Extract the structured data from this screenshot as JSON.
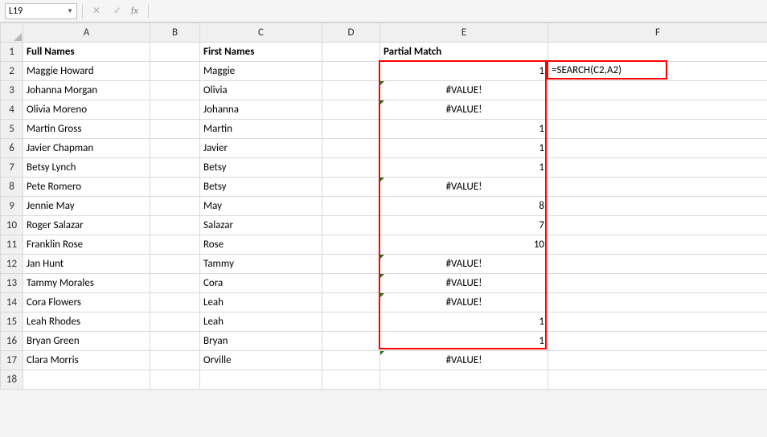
{
  "name_box": "L19",
  "fx_label": "fx",
  "cancel_glyph": "✕",
  "enter_glyph": "✓",
  "columns": [
    "A",
    "B",
    "C",
    "D",
    "E",
    "F"
  ],
  "headers": {
    "a": "Full Names",
    "c": "First Names",
    "e": "Partial Match"
  },
  "formula_display": "=SEARCH(C2,A2)",
  "rows": [
    {
      "r": 2,
      "a": "Maggie Howard",
      "c": "Maggie",
      "e": "1",
      "etype": "num"
    },
    {
      "r": 3,
      "a": "Johanna Morgan",
      "c": "Olivia",
      "e": "#VALUE!",
      "etype": "err"
    },
    {
      "r": 4,
      "a": "Olivia Moreno",
      "c": "Johanna",
      "e": "#VALUE!",
      "etype": "err"
    },
    {
      "r": 5,
      "a": "Martin Gross",
      "c": "Martin",
      "e": "1",
      "etype": "num"
    },
    {
      "r": 6,
      "a": "Javier Chapman",
      "c": "Javier",
      "e": "1",
      "etype": "num"
    },
    {
      "r": 7,
      "a": "Betsy Lynch",
      "c": "Betsy",
      "e": "1",
      "etype": "num"
    },
    {
      "r": 8,
      "a": "Pete Romero",
      "c": "Betsy",
      "e": "#VALUE!",
      "etype": "err"
    },
    {
      "r": 9,
      "a": "Jennie May",
      "c": "May",
      "e": "8",
      "etype": "num"
    },
    {
      "r": 10,
      "a": "Roger Salazar",
      "c": "Salazar",
      "e": "7",
      "etype": "num"
    },
    {
      "r": 11,
      "a": "Franklin Rose",
      "c": "Rose",
      "e": "10",
      "etype": "num"
    },
    {
      "r": 12,
      "a": "Jan Hunt",
      "c": "Tammy",
      "e": "#VALUE!",
      "etype": "err"
    },
    {
      "r": 13,
      "a": "Tammy Morales",
      "c": "Cora",
      "e": "#VALUE!",
      "etype": "err"
    },
    {
      "r": 14,
      "a": "Cora Flowers",
      "c": "Leah",
      "e": "#VALUE!",
      "etype": "err"
    },
    {
      "r": 15,
      "a": "Leah Rhodes",
      "c": "Leah",
      "e": "1",
      "etype": "num"
    },
    {
      "r": 16,
      "a": "Bryan Green",
      "c": "Bryan",
      "e": "1",
      "etype": "num"
    },
    {
      "r": 17,
      "a": "Clara Morris",
      "c": "Orville",
      "e": "#VALUE!",
      "etype": "err"
    }
  ],
  "empty_tail_rows": [
    18
  ]
}
